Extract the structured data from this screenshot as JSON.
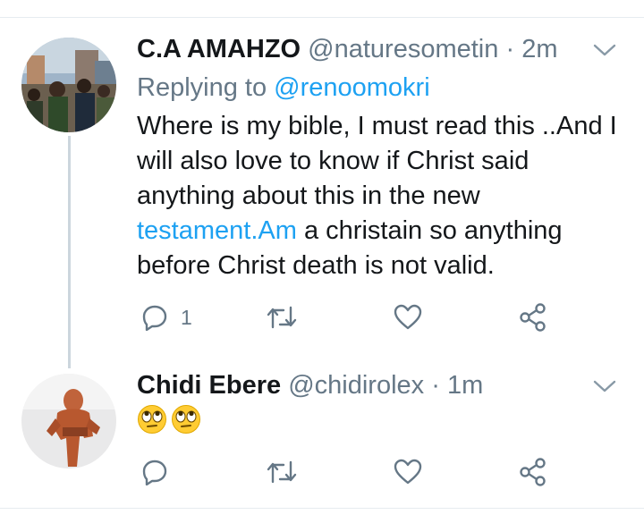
{
  "colors": {
    "link": "#1da1f2",
    "muted": "#657786",
    "text": "#14171a",
    "divider": "#e6ecf0",
    "thread_line": "#ccd6dd"
  },
  "tweets": [
    {
      "display_name": "C.A AMAHZO",
      "handle": "@naturesometin",
      "separator": "·",
      "time": "2m",
      "replying_prefix": "Replying to",
      "replying_to": "@renoomokri",
      "text_lines": [
        "Where is my bible, I must read this ..And I",
        "will also love to know if Christ said",
        "anything about this in the new"
      ],
      "text_link": "testament.Am",
      "text_after_link": "a christain so anything",
      "text_last_line": "before Christ death is not valid.",
      "reply_count": "1",
      "icons": [
        "reply-icon",
        "retweet-icon",
        "like-icon",
        "share-icon",
        "chevron-down-icon"
      ]
    },
    {
      "display_name": "Chidi Ebere",
      "handle": "@chidirolex",
      "separator": "·",
      "time": "1m",
      "emojis": [
        "🙄",
        "🙄"
      ],
      "icons": [
        "reply-icon",
        "retweet-icon",
        "like-icon",
        "share-icon",
        "chevron-down-icon"
      ]
    }
  ]
}
